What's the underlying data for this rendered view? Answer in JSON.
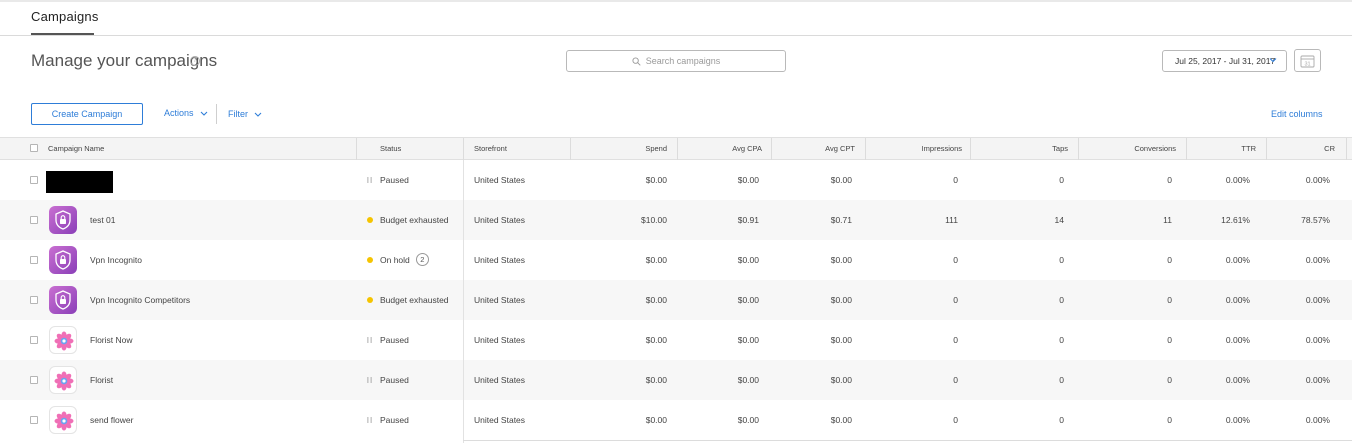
{
  "header": {
    "tab_label": "Campaigns"
  },
  "page": {
    "title": "Manage your campaigns",
    "help_glyph": "?"
  },
  "search": {
    "placeholder": "Search campaigns"
  },
  "date_range": {
    "label": "Jul 25, 2017 - Jul 31, 2017",
    "calendar_glyph": "31"
  },
  "toolbar": {
    "create_label": "Create Campaign",
    "actions_label": "Actions",
    "filter_label": "Filter",
    "edit_columns_label": "Edit columns"
  },
  "table": {
    "columns": [
      "Campaign Name",
      "Status",
      "Storefront",
      "Spend",
      "Avg CPA",
      "Avg CPT",
      "Impressions",
      "Taps",
      "Conversions",
      "TTR",
      "CR"
    ],
    "rows": [
      {
        "name": "",
        "icon": "redacted-icon",
        "status": "Paused",
        "status_type": "paused",
        "storefront": "United States",
        "spend": "$0.00",
        "avg_cpa": "$0.00",
        "avg_cpt": "$0.00",
        "impressions": "0",
        "taps": "0",
        "conversions": "0",
        "ttr": "0.00%",
        "cr": "0.00%"
      },
      {
        "name": "test 01",
        "icon": "vpn-shield-icon",
        "status": "Budget exhausted",
        "status_type": "warning",
        "storefront": "United States",
        "spend": "$10.00",
        "avg_cpa": "$0.91",
        "avg_cpt": "$0.71",
        "impressions": "111",
        "taps": "14",
        "conversions": "11",
        "ttr": "12.61%",
        "cr": "78.57%"
      },
      {
        "name": "Vpn Incognito",
        "icon": "vpn-shield-icon",
        "status": "On hold",
        "status_badge": "2",
        "status_type": "warning",
        "storefront": "United States",
        "spend": "$0.00",
        "avg_cpa": "$0.00",
        "avg_cpt": "$0.00",
        "impressions": "0",
        "taps": "0",
        "conversions": "0",
        "ttr": "0.00%",
        "cr": "0.00%"
      },
      {
        "name": "Vpn Incognito Competitors",
        "icon": "vpn-shield-icon",
        "status": "Budget exhausted",
        "status_type": "warning",
        "storefront": "United States",
        "spend": "$0.00",
        "avg_cpa": "$0.00",
        "avg_cpt": "$0.00",
        "impressions": "0",
        "taps": "0",
        "conversions": "0",
        "ttr": "0.00%",
        "cr": "0.00%"
      },
      {
        "name": "Florist Now",
        "icon": "flower-icon",
        "status": "Paused",
        "status_type": "paused",
        "storefront": "United States",
        "spend": "$0.00",
        "avg_cpa": "$0.00",
        "avg_cpt": "$0.00",
        "impressions": "0",
        "taps": "0",
        "conversions": "0",
        "ttr": "0.00%",
        "cr": "0.00%"
      },
      {
        "name": "Florist",
        "icon": "flower-icon",
        "status": "Paused",
        "status_type": "paused",
        "storefront": "United States",
        "spend": "$0.00",
        "avg_cpa": "$0.00",
        "avg_cpt": "$0.00",
        "impressions": "0",
        "taps": "0",
        "conversions": "0",
        "ttr": "0.00%",
        "cr": "0.00%"
      },
      {
        "name": "send flower",
        "icon": "flower-icon",
        "status": "Paused",
        "status_type": "paused",
        "storefront": "United States",
        "spend": "$0.00",
        "avg_cpa": "$0.00",
        "avg_cpt": "$0.00",
        "impressions": "0",
        "taps": "0",
        "conversions": "0",
        "ttr": "0.00%",
        "cr": "0.00%"
      }
    ]
  },
  "colors": {
    "accent": "#2e7dd8",
    "warning_dot": "#f5c400",
    "vpn_icon_from": "#c96fd1",
    "vpn_icon_to": "#8a3fb8",
    "flower_pink": "#f06fb6"
  }
}
